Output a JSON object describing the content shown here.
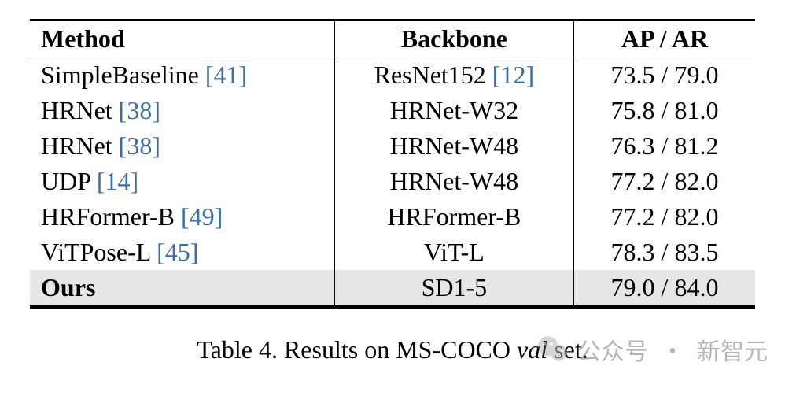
{
  "chart_data": {
    "type": "table",
    "title": "Table 4. Results on MS-COCO val set.",
    "columns": [
      "Method",
      "Backbone",
      "AP / AR"
    ],
    "rows": [
      {
        "method": "SimpleBaseline",
        "cite": "41",
        "backbone": "ResNet152",
        "backbone_cite": "12",
        "ap": 73.5,
        "ar": 79.0,
        "highlight": false
      },
      {
        "method": "HRNet",
        "cite": "38",
        "backbone": "HRNet-W32",
        "backbone_cite": null,
        "ap": 75.8,
        "ar": 81.0,
        "highlight": false
      },
      {
        "method": "HRNet",
        "cite": "38",
        "backbone": "HRNet-W48",
        "backbone_cite": null,
        "ap": 76.3,
        "ar": 81.2,
        "highlight": false
      },
      {
        "method": "UDP",
        "cite": "14",
        "backbone": "HRNet-W48",
        "backbone_cite": null,
        "ap": 77.2,
        "ar": 82.0,
        "highlight": false
      },
      {
        "method": "HRFormer-B",
        "cite": "49",
        "backbone": "HRFormer-B",
        "backbone_cite": null,
        "ap": 77.2,
        "ar": 82.0,
        "highlight": false
      },
      {
        "method": "ViTPose-L",
        "cite": "45",
        "backbone": "ViT-L",
        "backbone_cite": null,
        "ap": 78.3,
        "ar": 83.5,
        "highlight": false
      },
      {
        "method": "Ours",
        "cite": null,
        "backbone": "SD1-5",
        "backbone_cite": null,
        "ap": 79.0,
        "ar": 84.0,
        "highlight": true
      }
    ]
  },
  "header": {
    "method": "Method",
    "backbone": "Backbone",
    "apar": "AP / AR"
  },
  "rows": {
    "0": {
      "method": "SimpleBaseline ",
      "cite": "41",
      "backbone_pre": "ResNet152 ",
      "backbone_cite": "12",
      "backbone_post": "",
      "apar": "73.5 / 79.0"
    },
    "1": {
      "method": "HRNet ",
      "cite": "38",
      "backbone_pre": "HRNet-W32",
      "backbone_cite": "",
      "backbone_post": "",
      "apar": "75.8 / 81.0"
    },
    "2": {
      "method": "HRNet ",
      "cite": "38",
      "backbone_pre": "HRNet-W48",
      "backbone_cite": "",
      "backbone_post": "",
      "apar": "76.3 / 81.2"
    },
    "3": {
      "method": "UDP ",
      "cite": "14",
      "backbone_pre": "HRNet-W48",
      "backbone_cite": "",
      "backbone_post": "",
      "apar": "77.2 / 82.0"
    },
    "4": {
      "method": "HRFormer-B ",
      "cite": "49",
      "backbone_pre": "HRFormer-B",
      "backbone_cite": "",
      "backbone_post": "",
      "apar": "77.2 / 82.0"
    },
    "5": {
      "method": "ViTPose-L ",
      "cite": "45",
      "backbone_pre": "ViT-L",
      "backbone_cite": "",
      "backbone_post": "",
      "apar": "78.3 / 83.5"
    },
    "6": {
      "method": "Ours",
      "cite": "",
      "backbone_pre": "SD1-5",
      "backbone_cite": "",
      "backbone_post": "",
      "apar": "79.0 / 84.0"
    }
  },
  "caption": {
    "before": "Table 4. Results on MS-COCO ",
    "ital": "val",
    "after": " set."
  },
  "watermark": {
    "label_left": "公众号",
    "dot": "·",
    "label_right": "新智元"
  }
}
